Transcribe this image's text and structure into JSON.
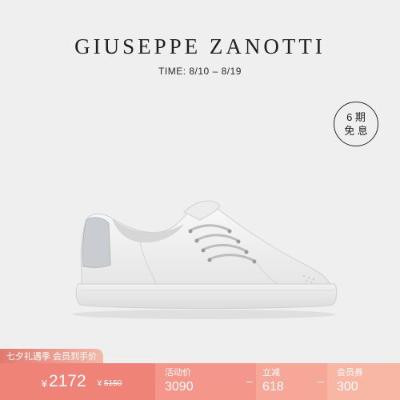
{
  "brand": "GIUSEPPE ZANOTTI",
  "time": "TIME: 8/10 – 8/19",
  "badge": {
    "line1": "6 期",
    "line2": "免 息"
  },
  "promo_tag": "七夕礼遇季 会员到手价",
  "price_bar": {
    "currency": "¥",
    "final_price": "2172",
    "original": {
      "currency": "¥",
      "value": "5150"
    },
    "items": [
      {
        "label": "活动价",
        "value": "3090",
        "operator": "–"
      },
      {
        "label": "立减",
        "value": "618",
        "operator": "–"
      },
      {
        "label": "会员券",
        "value": "300"
      }
    ]
  },
  "colors": {
    "bar1": "#ef8377",
    "bar2": "#f49689",
    "bar3": "#f6a797",
    "bar4": "#f8b7a4",
    "background": "#efefef"
  }
}
